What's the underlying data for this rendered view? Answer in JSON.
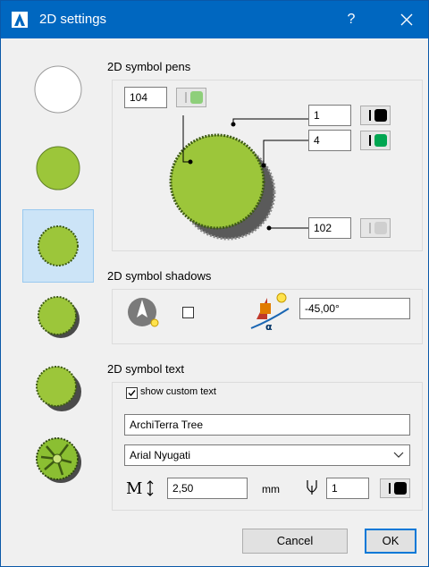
{
  "window": {
    "title": "2D settings",
    "help_label": "?",
    "accent": "#0067c0"
  },
  "presets": [
    {
      "icon": "plain-circle-icon"
    },
    {
      "icon": "filled-circle-icon"
    },
    {
      "icon": "tree-canopy-icon",
      "selected": true
    },
    {
      "icon": "tree-canopy-shadow-icon"
    },
    {
      "icon": "tree-canopy-large-shadow-icon"
    },
    {
      "icon": "tree-branches-icon"
    }
  ],
  "symbol_pens": {
    "title": "2D symbol pens",
    "fill_pen": "104",
    "outline_pen": "1",
    "detail_pen": "4",
    "shadow_pen": "102",
    "colors": {
      "fill": "#8ecf7a",
      "outline": "#000000",
      "detail": "#00a651",
      "shadow": "#cfcfcf"
    }
  },
  "symbol_shadows": {
    "title": "2D symbol shadows",
    "shadow_enabled": false,
    "angle": "-45,00°"
  },
  "symbol_text": {
    "title": "2D symbol text",
    "show_custom_text_label": "show custom text",
    "show_custom_text_checked": true,
    "text_value": "ArchiTerra Tree",
    "font_value": "Arial Nyugati",
    "text_height": "2,50",
    "unit": "mm",
    "text_pen": "1"
  },
  "footer": {
    "cancel_label": "Cancel",
    "ok_label": "OK"
  }
}
